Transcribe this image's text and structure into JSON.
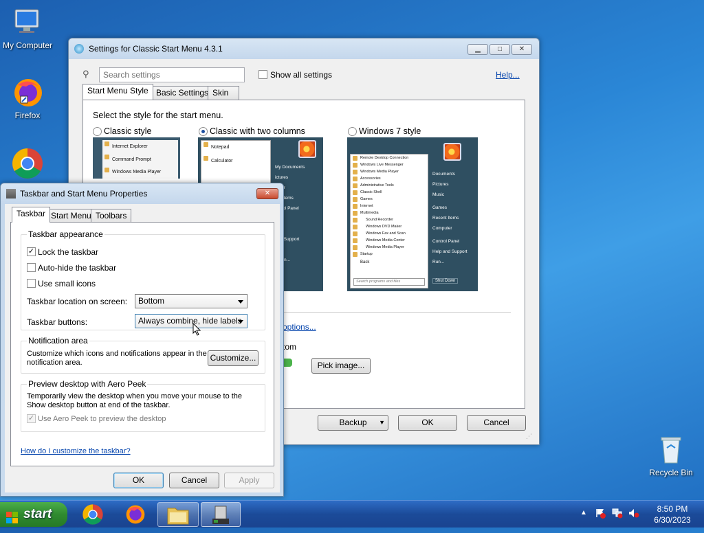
{
  "desktop": {
    "icons": [
      {
        "label": "My Computer"
      },
      {
        "label": "Firefox"
      },
      {
        "label": ""
      },
      {
        "label": "Recycle Bin"
      }
    ]
  },
  "classic_settings": {
    "title": "Settings for Classic Start Menu 4.3.1",
    "search_placeholder": "Search settings",
    "show_all_label": "Show all settings",
    "help_link": "Help...",
    "tabs": [
      "Start Menu Style",
      "Basic Settings",
      "Skin"
    ],
    "select_prompt": "Select the style for the start menu.",
    "styles": [
      {
        "label": "Classic style",
        "selected": false
      },
      {
        "label": "Classic with two columns",
        "selected": true
      },
      {
        "label": "Windows 7 style",
        "selected": false
      }
    ],
    "classic_preview_items": [
      "Internet Explorer",
      "Command Prompt",
      "Windows Media Player"
    ],
    "two_col_preview": {
      "left_items": [
        "Notepad",
        "Calculator"
      ],
      "right_items": [
        "My Documents",
        "ictures",
        "puter",
        "ent Items",
        "ontrol Panel",
        "ters",
        "ch",
        "and Support",
        "",
        "Down..."
      ]
    },
    "win7_preview": {
      "left_items": [
        "Remote Desktop Connection",
        "Windows Live Messenger",
        "Windows Media Player",
        "Accessories",
        "Administrative Tools",
        "Classic Shell",
        "Games",
        "Internet",
        "Multimedia",
        "Sound Recorder",
        "Windows DVD Maker",
        "Windows Fax and Scan",
        "Windows Media Center",
        "Windows Media Player",
        "Startup"
      ],
      "back_label": "Back",
      "search_placeholder": "Search programs and files",
      "right_items": [
        "Documents",
        "Pictures",
        "Music",
        "Games",
        "Recent Items",
        "Computer",
        "Control Panel",
        "Help and Support",
        "Run..."
      ],
      "shutdown_label": "Shut Down"
    },
    "options_link": "options...",
    "partial_label": "tom",
    "pick_image_button": "Pick image...",
    "backup_button": "Backup",
    "ok_button": "OK",
    "cancel_button": "Cancel"
  },
  "taskbar_props": {
    "title": "Taskbar and Start Menu Properties",
    "tabs": [
      "Taskbar",
      "Start Menu",
      "Toolbars"
    ],
    "appearance_group": "Taskbar appearance",
    "lock_label": "Lock the taskbar",
    "lock_checked": true,
    "autohide_label": "Auto-hide the taskbar",
    "autohide_checked": false,
    "small_icons_label": "Use small icons",
    "small_icons_checked": false,
    "location_label": "Taskbar location on screen:",
    "location_value": "Bottom",
    "buttons_label": "Taskbar buttons:",
    "buttons_value": "Always combine, hide labels",
    "notification_group": "Notification area",
    "notification_text": "Customize which icons and notifications appear in the notification area.",
    "customize_button": "Customize...",
    "aero_group": "Preview desktop with Aero Peek",
    "aero_text": "Temporarily view the desktop when you move your mouse to the Show desktop button at end of the taskbar.",
    "aero_checkbox_label": "Use Aero Peek to preview the desktop",
    "aero_checked": true,
    "help_link": "How do I customize the taskbar?",
    "ok_button": "OK",
    "cancel_button": "Cancel",
    "apply_button": "Apply"
  },
  "taskbar": {
    "start_label": "start",
    "time": "8:50 PM",
    "date": "6/30/2023"
  },
  "colors": {
    "accent": "#0645ad",
    "start_green": "#2f8a2f",
    "taskbar_blue": "#1b4b99"
  }
}
